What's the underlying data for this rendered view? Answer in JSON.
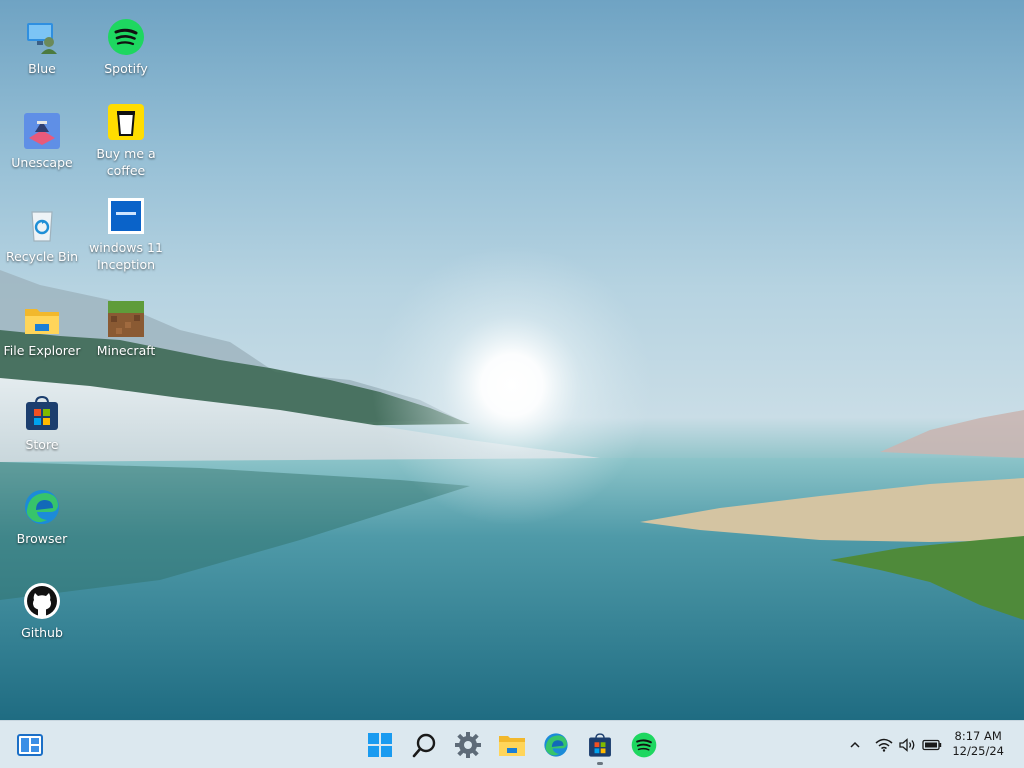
{
  "desktop": {
    "icons": [
      {
        "label": "Blue",
        "icon": "blue-user-monitor-icon"
      },
      {
        "label": "Spotify",
        "icon": "spotify-icon"
      },
      {
        "label": "Unescape",
        "icon": "unescape-game-icon"
      },
      {
        "label": "Buy me a coffee",
        "icon": "coffee-cup-icon"
      },
      {
        "label": "Recycle Bin",
        "icon": "recycle-bin-icon"
      },
      {
        "label": "windows 11 Inception",
        "icon": "windows-inception-icon"
      },
      {
        "label": "File Explorer",
        "icon": "folder-icon"
      },
      {
        "label": "Minecraft",
        "icon": "minecraft-grass-block-icon"
      },
      {
        "label": "Store",
        "icon": "store-bag-icon"
      },
      {
        "label": "Browser",
        "icon": "edge-browser-icon"
      },
      {
        "label": "Github",
        "icon": "github-icon"
      }
    ]
  },
  "taskbar": {
    "widgets_icon": "widgets-icon",
    "pinned": [
      {
        "name": "start",
        "icon": "windows-start-icon"
      },
      {
        "name": "search",
        "icon": "search-icon"
      },
      {
        "name": "settings",
        "icon": "gear-icon"
      },
      {
        "name": "file-explorer",
        "icon": "folder-icon"
      },
      {
        "name": "edge",
        "icon": "edge-browser-icon"
      },
      {
        "name": "store",
        "icon": "store-bag-icon",
        "active": true
      },
      {
        "name": "spotify",
        "icon": "spotify-icon"
      }
    ],
    "tray": {
      "chevron": "chevron-up-icon",
      "wifi": "wifi-icon",
      "volume": "speaker-icon",
      "battery": "battery-icon"
    },
    "clock": {
      "time": "8:17 AM",
      "date": "12/25/24"
    }
  },
  "colors": {
    "taskbar_bg": "#dce8ef",
    "spotify_green": "#1ed760",
    "windows_blue": "#0078d4"
  }
}
